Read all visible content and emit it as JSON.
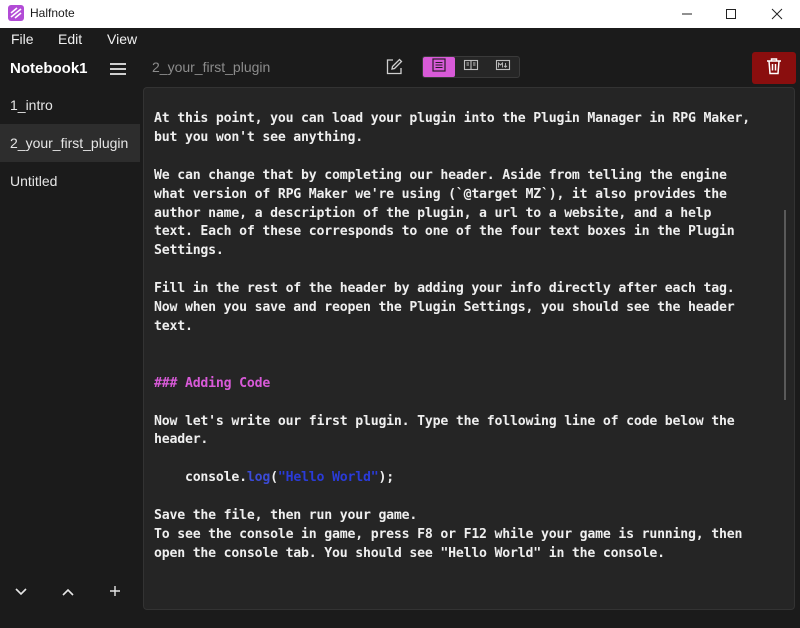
{
  "window": {
    "title": "Halfnote",
    "accent": "#d85ad8",
    "danger": "#8a0e0e"
  },
  "menu": {
    "items": [
      "File",
      "Edit",
      "View"
    ]
  },
  "sidebar": {
    "notebook_title": "Notebook1",
    "notes": [
      {
        "label": "1_intro",
        "active": false
      },
      {
        "label": "2_your_first_plugin",
        "active": true
      },
      {
        "label": "Untitled",
        "active": false
      }
    ],
    "footer_icons": [
      "chevron-down-icon",
      "chevron-up-icon",
      "plus-icon"
    ]
  },
  "toolbar": {
    "file_title": "2_your_first_plugin",
    "view_modes": [
      "editor-view-icon",
      "split-view-icon",
      "markdown-preview-icon"
    ],
    "active_view": 0
  },
  "editor": {
    "paragraph1_line1": "At this point, you can load your plugin into the Plugin Manager in RPG Maker,",
    "paragraph1_line2": "but you won't see anything.",
    "paragraph2_line1": "We can change that by completing our header. Aside from telling the engine",
    "paragraph2_line2": "what version of RPG Maker we're using (`@target MZ`), it also provides the",
    "paragraph2_line3": "author name, a description of the plugin, a url to a website, and a help",
    "paragraph2_line4": "text. Each of these corresponds to one of the four text boxes in the Plugin",
    "paragraph2_line5": "Settings.",
    "paragraph3_line1": "Fill in the rest of the header by adding your info directly after each tag.",
    "paragraph3_line2": "Now when you save and reopen the Plugin Settings, you should see the header",
    "paragraph3_line3": "text.",
    "heading": "### Adding Code",
    "paragraph4_line1": "Now let's write our first plugin. Type the following line of code below the",
    "paragraph4_line2": "header.",
    "code_indent": "    console.",
    "code_fn": "log",
    "code_open": "(",
    "code_string": "\"Hello World\"",
    "code_close": ");",
    "paragraph5_line1": "Save the file, then run your game.",
    "paragraph5_line2": "To see the console in game, press F8 or F12 while your game is running, then",
    "paragraph5_line3": "open the console tab. You should see \"Hello World\" in the console."
  }
}
